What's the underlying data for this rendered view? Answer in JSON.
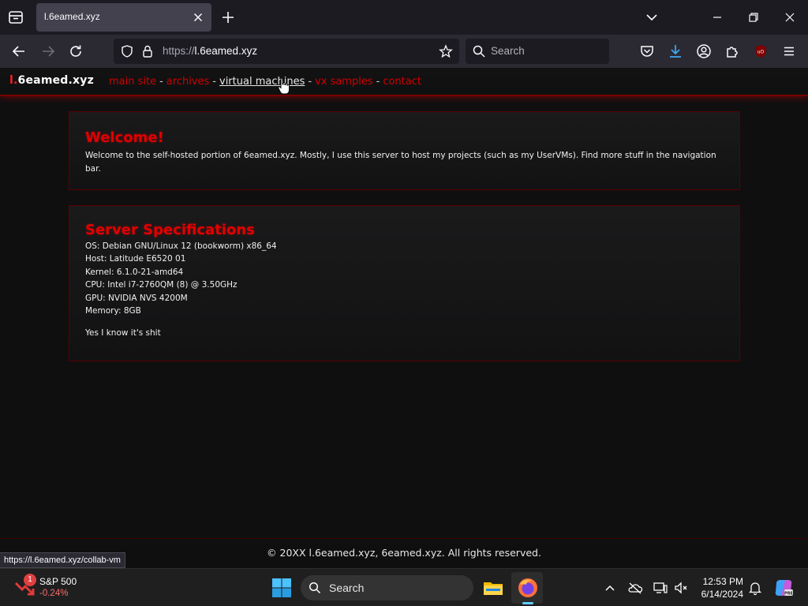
{
  "browser": {
    "tab_title": "l.6eamed.xyz",
    "url_scheme": "https://",
    "url_host": "l.6eamed.xyz",
    "search_placeholder": "Search",
    "status_url": "https://l.6eamed.xyz/collab-vm"
  },
  "site": {
    "logo_prefix": "l.",
    "logo_main": "6eamed.xyz",
    "nav": [
      {
        "label": "main site"
      },
      {
        "label": "archives"
      },
      {
        "label": "virtual machines",
        "active": true
      },
      {
        "label": "vx samples"
      },
      {
        "label": "contact"
      }
    ],
    "separator": "-",
    "welcome": {
      "heading": "Welcome!",
      "text": "Welcome to the self-hosted portion of 6eamed.xyz. Mostly, I use this server to host my projects (such as my UserVMs). Find more stuff in the navigation bar."
    },
    "specs": {
      "heading": "Server Specifications",
      "lines": [
        "OS: Debian GNU/Linux 12 (bookworm) x86_64",
        "Host: Latitude E6520 01",
        "Kernel: 6.1.0-21-amd64",
        "CPU: Intel i7-2760QM (8) @ 3.50GHz",
        "GPU: NVIDIA NVS 4200M",
        "Memory: 8GB"
      ],
      "footnote": "Yes I know it's shit"
    },
    "footer": "© 20XX l.6eamed.xyz, 6eamed.xyz. All rights reserved."
  },
  "taskbar": {
    "widget_title": "S&P 500",
    "widget_change": "-0.24%",
    "widget_badge": "1",
    "search_label": "Search",
    "time": "12:53 PM",
    "date": "6/14/2024"
  },
  "colors": {
    "accent_red": "#e00000",
    "browser_bg": "#2b2a33",
    "page_bg": "#0f0f10"
  }
}
